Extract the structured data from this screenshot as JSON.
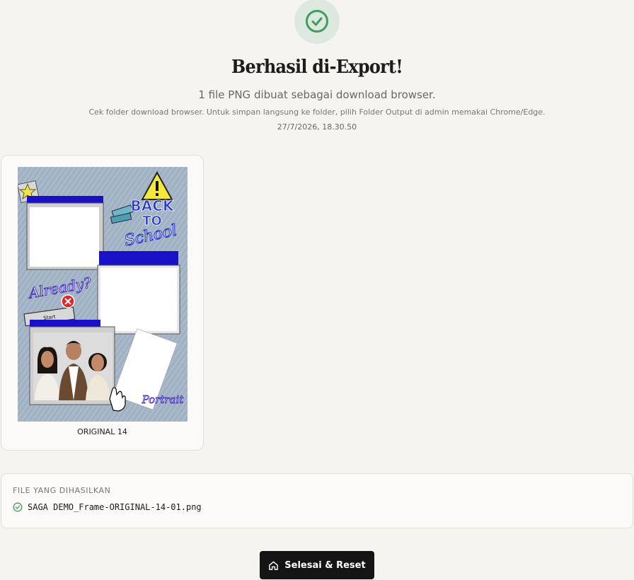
{
  "header": {
    "title": "Berhasil di-Export!",
    "subtitle": "1 file PNG dibuat sebagai download browser.",
    "hint": "Cek folder download browser. Untuk simpan langsung ke folder, pilih Folder Output di admin memakai Chrome/Edge.",
    "timestamp": "27/7/2026, 18.30.50",
    "icon": "check-circle-icon",
    "accent": "#3e9e5c"
  },
  "results": [
    {
      "label": "ORIGINAL 14",
      "frame_texts": {
        "back": "BACK",
        "to": "TO",
        "school": "School",
        "already": "Already?",
        "start": "Start",
        "portrait": "Portrait"
      }
    }
  ],
  "files": {
    "heading": "FILE YANG DIHASILKAN",
    "items": [
      {
        "name": "SAGA DEMO_Frame-ORIGINAL-14-01.png",
        "status_icon": "check-circle-icon"
      }
    ]
  },
  "actions": {
    "done_label": "Selesai & Reset",
    "done_icon": "home-icon"
  }
}
